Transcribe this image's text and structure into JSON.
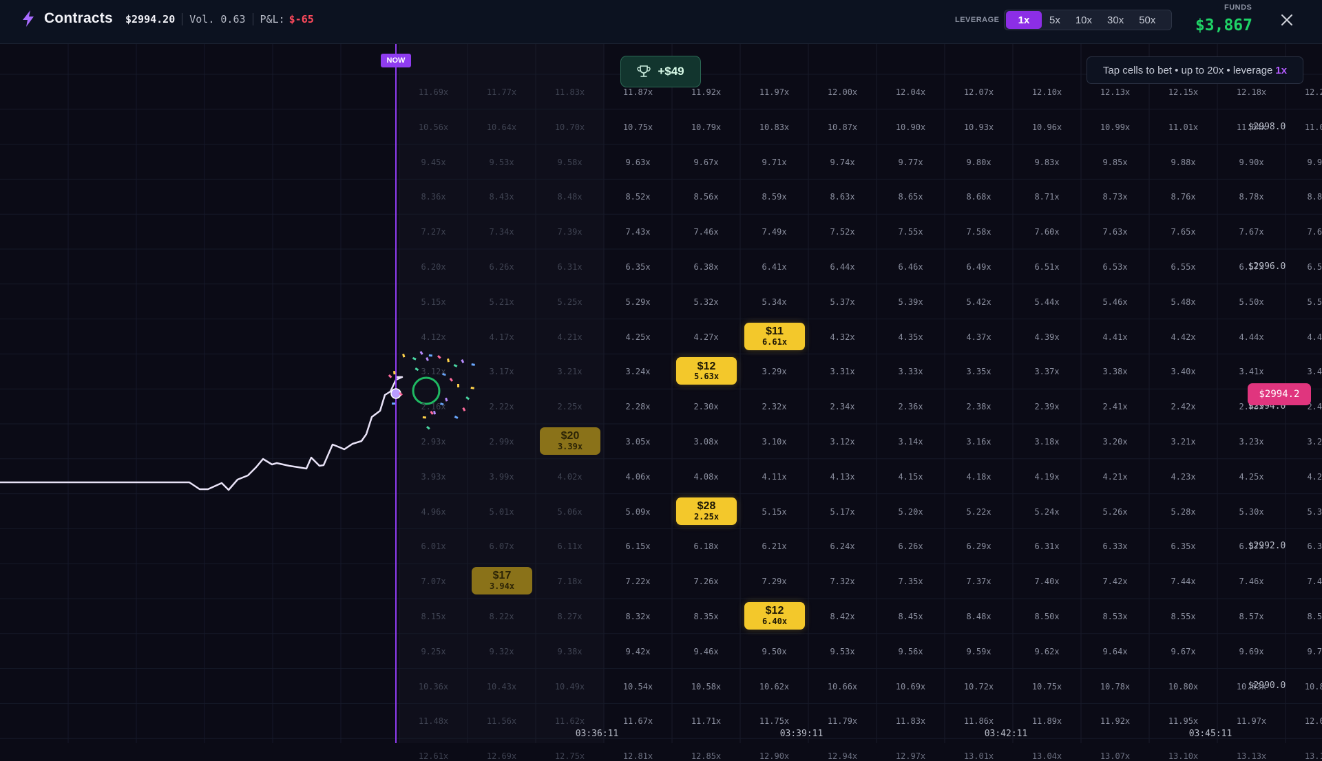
{
  "header": {
    "title": "Contracts",
    "price": "$2994.20",
    "volume": "Vol. 0.63",
    "pnl_label": "P&L:",
    "pnl_value": "$-65",
    "leverage_label": "LEVERAGE",
    "leverage_options": [
      "1x",
      "5x",
      "10x",
      "30x",
      "50x"
    ],
    "leverage_selected": "1x",
    "funds_label": "FUNDS",
    "funds_value": "$3,867"
  },
  "chart": {
    "now_label": "NOW",
    "win_badge": "+$49",
    "hint_text": "Tap cells to bet • up to 20x • leverage",
    "hint_leverage": "1x",
    "current_price_label": "$2994.2",
    "price_labels": [
      "$2998.0",
      "$2996.0",
      "$2994.0",
      "$2992.0",
      "$2990.0"
    ],
    "time_labels": [
      "03:36:11",
      "03:39:11",
      "03:42:11",
      "03:45:11"
    ],
    "multiplier_columns": [
      [
        "11.69x",
        "10.56x",
        "9.45x",
        "8.36x",
        "7.27x",
        "6.20x",
        "5.15x",
        "4.12x",
        "3.12x",
        "2.16x",
        "2.93x",
        "3.93x",
        "4.96x",
        "6.01x",
        "7.07x",
        "8.15x",
        "9.25x",
        "10.36x",
        "11.48x",
        "12.61x"
      ],
      [
        "11.77x",
        "10.64x",
        "9.53x",
        "8.43x",
        "7.34x",
        "6.26x",
        "5.21x",
        "4.17x",
        "3.17x",
        "2.22x",
        "2.99x",
        "3.99x",
        "5.01x",
        "6.07x",
        "7.13x",
        "8.22x",
        "9.32x",
        "10.43x",
        "11.56x",
        "12.69x"
      ],
      [
        "11.83x",
        "10.70x",
        "9.58x",
        "8.48x",
        "7.39x",
        "6.31x",
        "5.25x",
        "4.21x",
        "3.21x",
        "2.25x",
        "3.03x",
        "4.02x",
        "5.06x",
        "6.11x",
        "7.18x",
        "8.27x",
        "9.38x",
        "10.49x",
        "11.62x",
        "12.75x"
      ],
      [
        "11.87x",
        "10.75x",
        "9.63x",
        "8.52x",
        "7.43x",
        "6.35x",
        "5.29x",
        "4.25x",
        "3.24x",
        "2.28x",
        "3.05x",
        "4.06x",
        "5.09x",
        "6.15x",
        "7.22x",
        "8.32x",
        "9.42x",
        "10.54x",
        "11.67x",
        "12.81x"
      ],
      [
        "11.92x",
        "10.79x",
        "9.67x",
        "8.56x",
        "7.46x",
        "6.38x",
        "5.32x",
        "4.27x",
        "3.26x",
        "2.30x",
        "3.08x",
        "4.08x",
        "5.12x",
        "6.18x",
        "7.26x",
        "8.35x",
        "9.46x",
        "10.58x",
        "11.71x",
        "12.85x"
      ],
      [
        "11.97x",
        "10.83x",
        "9.71x",
        "8.59x",
        "7.49x",
        "6.41x",
        "5.34x",
        "4.30x",
        "3.29x",
        "2.32x",
        "3.10x",
        "4.11x",
        "5.15x",
        "6.21x",
        "7.29x",
        "8.38x",
        "9.50x",
        "10.62x",
        "11.75x",
        "12.90x"
      ],
      [
        "12.00x",
        "10.87x",
        "9.74x",
        "8.63x",
        "7.52x",
        "6.44x",
        "5.37x",
        "4.32x",
        "3.31x",
        "2.34x",
        "3.12x",
        "4.13x",
        "5.17x",
        "6.24x",
        "7.32x",
        "8.42x",
        "9.53x",
        "10.66x",
        "11.79x",
        "12.94x"
      ],
      [
        "12.04x",
        "10.90x",
        "9.77x",
        "8.65x",
        "7.55x",
        "6.46x",
        "5.39x",
        "4.35x",
        "3.33x",
        "2.36x",
        "3.14x",
        "4.15x",
        "5.20x",
        "6.26x",
        "7.35x",
        "8.45x",
        "9.56x",
        "10.69x",
        "11.83x",
        "12.97x"
      ],
      [
        "12.07x",
        "10.93x",
        "9.80x",
        "8.68x",
        "7.58x",
        "6.49x",
        "5.42x",
        "4.37x",
        "3.35x",
        "2.38x",
        "3.16x",
        "4.18x",
        "5.22x",
        "6.29x",
        "7.37x",
        "8.48x",
        "9.59x",
        "10.72x",
        "11.86x",
        "13.01x"
      ],
      [
        "12.10x",
        "10.96x",
        "9.83x",
        "8.71x",
        "7.60x",
        "6.51x",
        "5.44x",
        "4.39x",
        "3.37x",
        "2.39x",
        "3.18x",
        "4.19x",
        "5.24x",
        "6.31x",
        "7.40x",
        "8.50x",
        "9.62x",
        "10.75x",
        "11.89x",
        "13.04x"
      ],
      [
        "12.13x",
        "10.99x",
        "9.85x",
        "8.73x",
        "7.63x",
        "6.53x",
        "5.46x",
        "4.41x",
        "3.38x",
        "2.41x",
        "3.20x",
        "4.21x",
        "5.26x",
        "6.33x",
        "7.42x",
        "8.53x",
        "9.64x",
        "10.78x",
        "11.92x",
        "13.07x"
      ],
      [
        "12.15x",
        "11.01x",
        "9.88x",
        "8.76x",
        "7.65x",
        "6.55x",
        "5.48x",
        "4.42x",
        "3.40x",
        "2.42x",
        "3.21x",
        "4.23x",
        "5.28x",
        "6.35x",
        "7.44x",
        "8.55x",
        "9.67x",
        "10.80x",
        "11.95x",
        "13.10x"
      ],
      [
        "12.18x",
        "11.04x",
        "9.90x",
        "8.78x",
        "7.67x",
        "6.57x",
        "5.50x",
        "4.44x",
        "3.41x",
        "2.43x",
        "3.23x",
        "4.25x",
        "5.30x",
        "6.37x",
        "7.46x",
        "8.57x",
        "9.69x",
        "10.83x",
        "11.97x",
        "13.13x"
      ],
      [
        "12.21x",
        "11.06x",
        "9.93x",
        "8.80x",
        "7.69x",
        "6.59x",
        "5.51x",
        "4.46x",
        "3.43x",
        "2.45x",
        "3.24x",
        "4.26x",
        "5.32x",
        "6.39x",
        "7.48x",
        "8.59x",
        "9.72x",
        "10.85x",
        "12.00x",
        "13.16x"
      ]
    ],
    "bets": [
      {
        "amount": "$11",
        "multiplier": "6.61x",
        "col": 5,
        "row": 7,
        "state": "active"
      },
      {
        "amount": "$12",
        "multiplier": "5.63x",
        "col": 4,
        "row": 8,
        "state": "active"
      },
      {
        "amount": "$20",
        "multiplier": "3.39x",
        "col": 2,
        "row": 10,
        "state": "past"
      },
      {
        "amount": "$28",
        "multiplier": "2.25x",
        "col": 4,
        "row": 12,
        "state": "active"
      },
      {
        "amount": "$17",
        "multiplier": "3.94x",
        "col": 1,
        "row": 14,
        "state": "past"
      },
      {
        "amount": "$12",
        "multiplier": "6.40x",
        "col": 5,
        "row": 15,
        "state": "active"
      }
    ],
    "colors": {
      "accent": "#8f3cf0",
      "bet_active": "#f3c82b",
      "bet_past": "#8a7219",
      "current_price": "#e0357e",
      "funds": "#1fd467",
      "pnl_negative": "#ff4a5c",
      "price_line": "#e9e3f7"
    },
    "icons": [
      "bolt-icon",
      "trophy-icon",
      "close-icon",
      "win-ring-icon"
    ]
  }
}
